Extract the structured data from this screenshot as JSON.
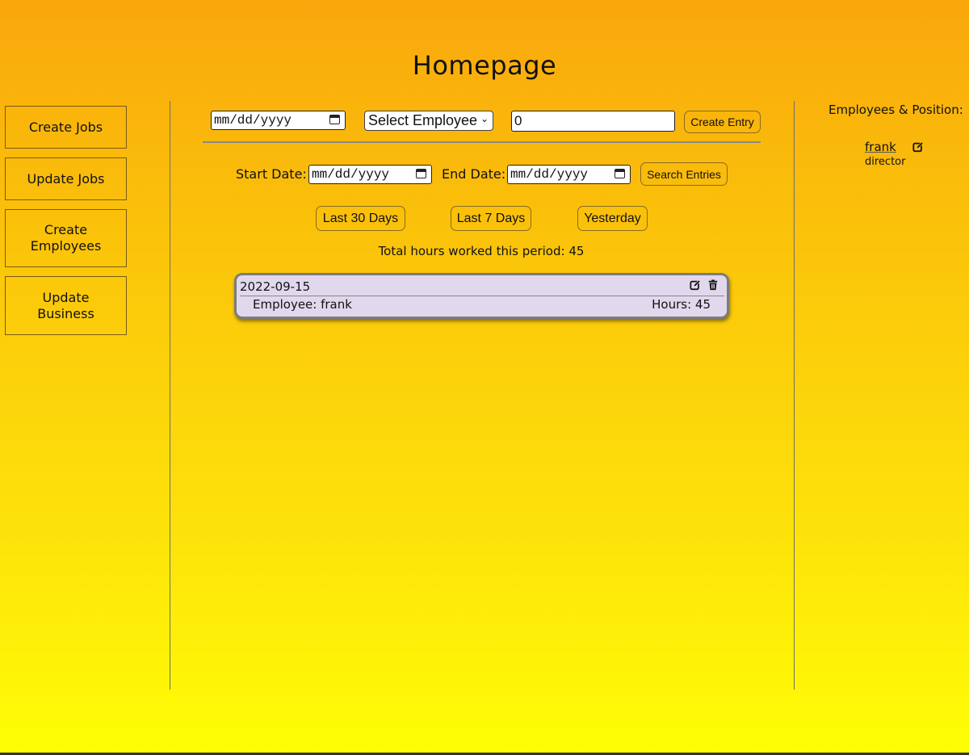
{
  "page_title": "Homepage",
  "sidebar": {
    "items": [
      {
        "label": "Create Jobs"
      },
      {
        "label": "Update Jobs"
      },
      {
        "label": "Create\nEmployees"
      },
      {
        "label": "Update\nBusiness"
      }
    ]
  },
  "entry_form": {
    "date_placeholder": "mm/dd/yyyy",
    "employee_select": "Select Employee",
    "hours_value": "0",
    "create_button": "Create Entry"
  },
  "search": {
    "start_label": "Start Date:",
    "start_placeholder": "mm/dd/yyyy",
    "end_label": "End Date:",
    "end_placeholder": "mm/dd/yyyy",
    "search_button": "Search Entries",
    "quick_ranges": [
      "Last 30 Days",
      "Last 7 Days",
      "Yesterday"
    ]
  },
  "total_hours_text": "Total hours worked this period: 45",
  "entries": [
    {
      "date": "2022-09-15",
      "employee": "Employee: frank",
      "hours": "Hours: 45"
    }
  ],
  "right_panel": {
    "title": "Employees & Position:",
    "employees": [
      {
        "name": "frank",
        "position": "director"
      }
    ]
  },
  "icons": {
    "edit": "edit-icon",
    "delete": "trash-icon",
    "calendar": "calendar-icon",
    "dropdown": "chevron-down-icon"
  },
  "colors": {
    "gradient_top": "#f9a70c",
    "gradient_bottom": "#fefe05",
    "card_bg": "#e2d8ee"
  }
}
